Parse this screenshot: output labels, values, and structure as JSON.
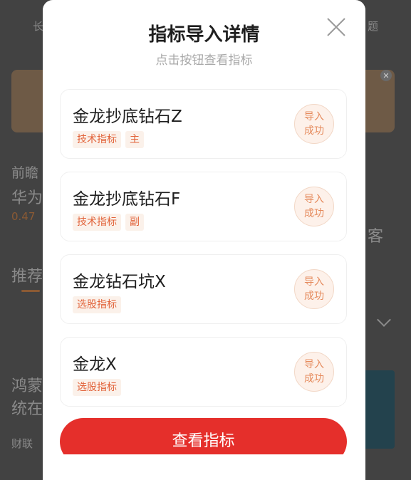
{
  "background": {
    "tab_left": "长",
    "tab_right": "题",
    "news_1_line1": "前瞻",
    "news_1_line2": "华为",
    "news_1_value": "0.47",
    "news_1_extra": "客",
    "section": "推荐",
    "news_2_line1": "鸿蒙",
    "news_2_line2": "统在",
    "news_2_source": "财联"
  },
  "modal": {
    "title": "指标导入详情",
    "subtitle": "点击按钮查看指标",
    "items": [
      {
        "name": "金龙抄底钻石Z",
        "tags": [
          "技术指标",
          "主"
        ],
        "status_line1": "导入",
        "status_line2": "成功"
      },
      {
        "name": "金龙抄底钻石F",
        "tags": [
          "技术指标",
          "副"
        ],
        "status_line1": "导入",
        "status_line2": "成功"
      },
      {
        "name": "金龙钻石坑X",
        "tags": [
          "选股指标"
        ],
        "status_line1": "导入",
        "status_line2": "成功"
      },
      {
        "name": "金龙X",
        "tags": [
          "选股指标"
        ],
        "status_line1": "导入",
        "status_line2": "成功"
      }
    ],
    "cta_label": "查看指标"
  },
  "colors": {
    "accent": "#e52f2b",
    "tag_text": "#e2633a",
    "status_text": "#e58a5c"
  },
  "icons": {
    "close": "close-icon"
  }
}
